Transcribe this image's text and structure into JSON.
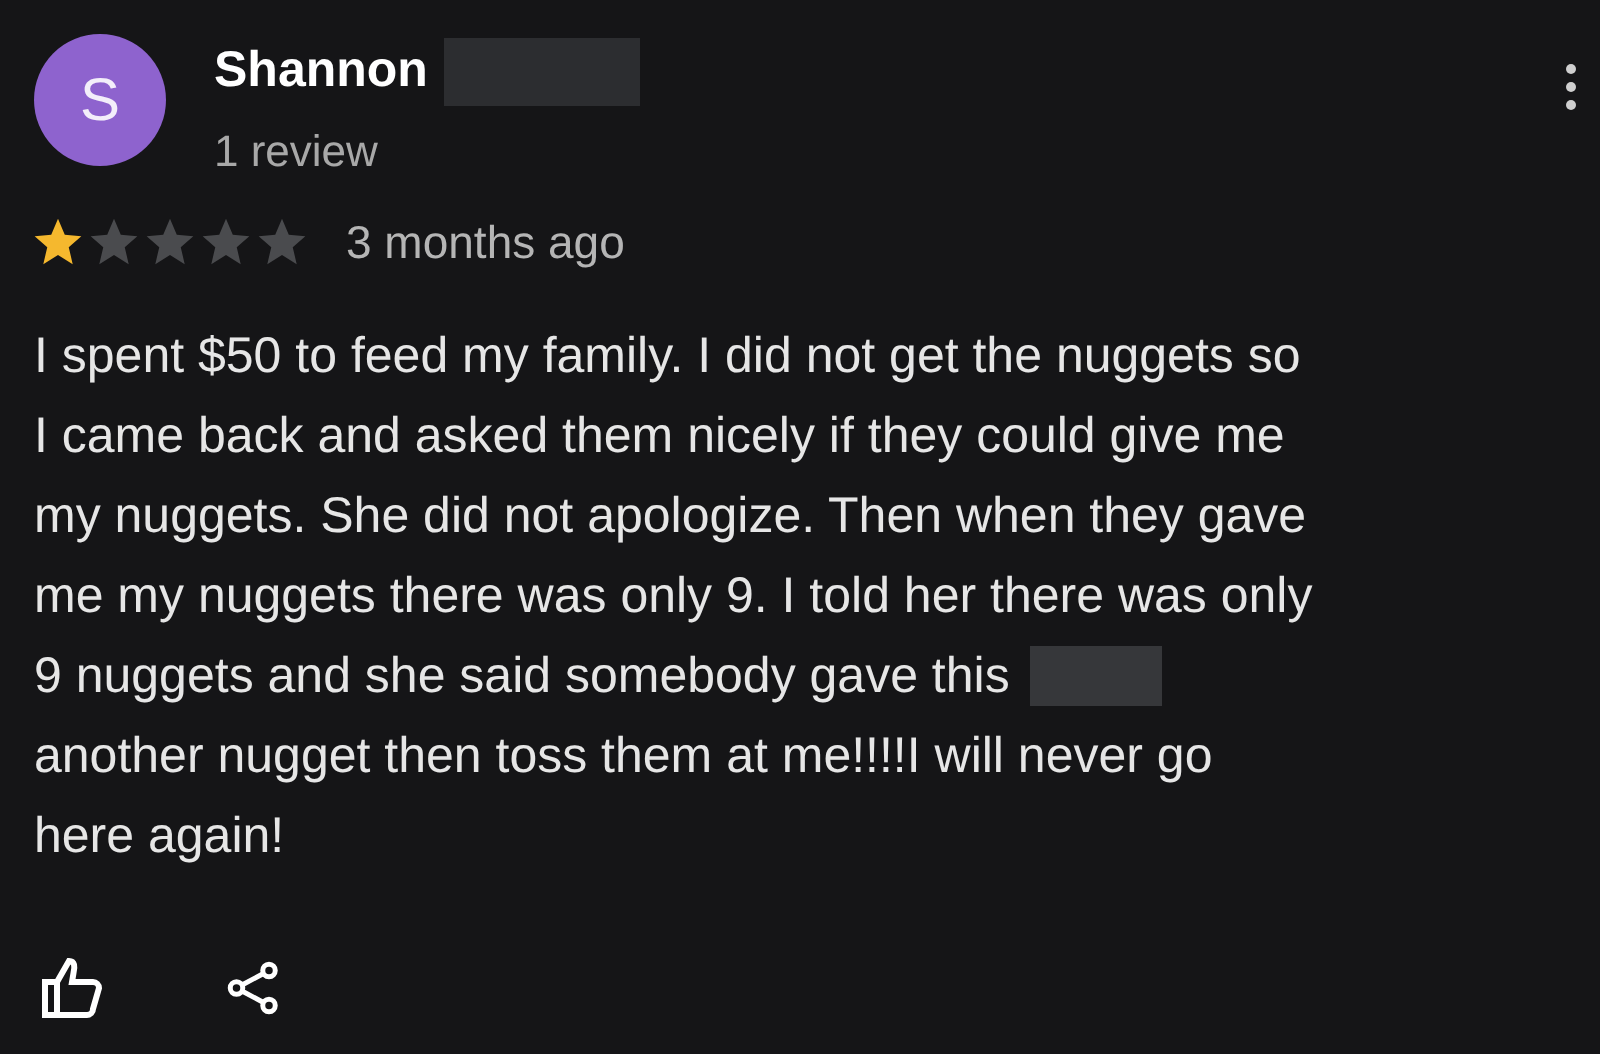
{
  "reviewer": {
    "initial": "S",
    "name": "Shannon",
    "reviews": "1 review"
  },
  "rating": {
    "stars": 1,
    "time": "3 months ago"
  },
  "review": {
    "lines": [
      {
        "kind": "plain",
        "text": "I spent $50 to feed my family. I did not get the nuggets so"
      },
      {
        "kind": "plain",
        "text": "I came back and asked them nicely if they could give me"
      },
      {
        "kind": "plain",
        "text": "my nuggets. She did not apologize. Then when they gave"
      },
      {
        "kind": "plain",
        "text": "me my nuggets there was only 9. I told her there was only"
      },
      {
        "kind": "redacted",
        "text": "9 nuggets and she said somebody gave this"
      },
      {
        "kind": "plain",
        "text": "another nugget then toss them at me!!!!I will never go"
      },
      {
        "kind": "plain",
        "text": "here again!"
      }
    ]
  }
}
